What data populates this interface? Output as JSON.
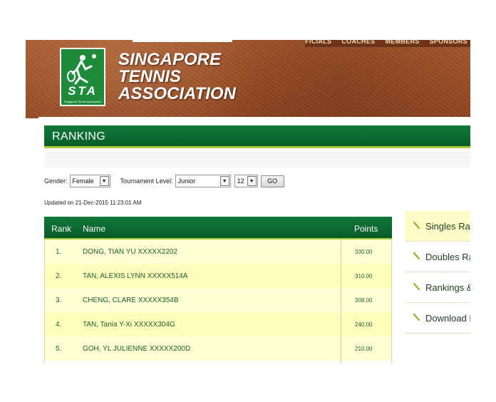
{
  "topnav": [
    "OFFICIALS",
    "COACHES",
    "MEMBERS",
    "SPONSORS"
  ],
  "logo": {
    "text": "STA",
    "subtext": "Singapore Tennis Association"
  },
  "org_name": [
    "SINGAPORE",
    "TENNIS",
    "ASSOCIATION"
  ],
  "section_title": "RANKING",
  "filters": {
    "gender_label": "Gender:",
    "gender_value": "Female",
    "level_label": "Tournament Level:",
    "level_value": "Junior",
    "age_value": "12",
    "go_label": "GO"
  },
  "updated": "Updated on 21-Dec-2015 11:23:01 AM",
  "table": {
    "headers": {
      "rank": "Rank",
      "name": "Name",
      "points": "Points"
    },
    "rows": [
      {
        "rank": "1.",
        "name": "DONG, TIAN YU XXXXX2202",
        "points": "330.00"
      },
      {
        "rank": "2.",
        "name": "TAN, ALEXIS LYNN XXXXX514A",
        "points": "310.00"
      },
      {
        "rank": "3.",
        "name": "CHENG, CLARE XXXXX354B",
        "points": "308.00"
      },
      {
        "rank": "4.",
        "name": "TAN, Tania Y-Xi XXXXX304G",
        "points": "240.00"
      },
      {
        "rank": "5.",
        "name": "GOH, YL JULIENNE XXXXX200D",
        "points": "210.00"
      }
    ]
  },
  "side_menu": [
    {
      "label": "Singles Ran",
      "active": true
    },
    {
      "label": "Doubles Ra",
      "active": false
    },
    {
      "label": "Rankings &",
      "active": false
    },
    {
      "label": "Download F",
      "active": false
    }
  ],
  "colors": {
    "brand_green": "#0b6a30",
    "accent_lime": "#a7cb3c",
    "clay": "#9a4e25",
    "row_yellow": "#ffffd6"
  }
}
